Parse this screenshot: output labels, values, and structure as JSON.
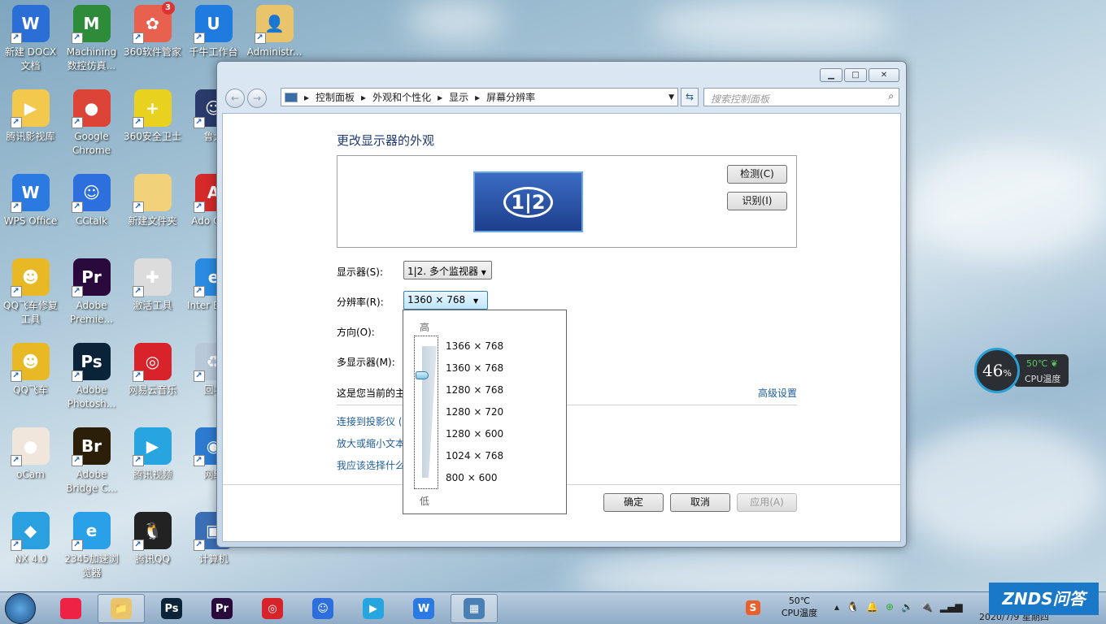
{
  "desktop_icons": [
    {
      "label": "新建 DOCX 文档",
      "glyph": "W",
      "color": "#2b6fd6"
    },
    {
      "label": "Machining 数控仿真...",
      "glyph": "M",
      "color": "#2e8b3a"
    },
    {
      "label": "360软件管家",
      "glyph": "✿",
      "color": "#e8614f",
      "badge": "3"
    },
    {
      "label": "千牛工作台",
      "glyph": "U",
      "color": "#1f7be0"
    },
    {
      "label": "Administr...",
      "glyph": "👤",
      "color": "#e9c46a"
    },
    {
      "label": "腾讯影视库",
      "glyph": "▶",
      "color": "#f2c94c"
    },
    {
      "label": "Google Chrome",
      "glyph": "●",
      "color": "#db4437"
    },
    {
      "label": "360安全卫士",
      "glyph": "+",
      "color": "#e8d21f"
    },
    {
      "label": "鲁大",
      "glyph": "☺",
      "color": "#2a3b6b"
    },
    {
      "label": "WPS Office",
      "glyph": "W",
      "color": "#2a7ae2"
    },
    {
      "label": "CCtalk",
      "glyph": "☺",
      "color": "#2d6fdc"
    },
    {
      "label": "新建文件夹",
      "glyph": "",
      "color": "#f1d27a"
    },
    {
      "label": "Ado Crea",
      "glyph": "A",
      "color": "#d42a2a"
    },
    {
      "label": "QQ飞车修复工具",
      "glyph": "☻",
      "color": "#e9b825"
    },
    {
      "label": "Adobe Premie...",
      "glyph": "Pr",
      "color": "#2a0a3d"
    },
    {
      "label": "激活工具",
      "glyph": "✚",
      "color": "#dcdcdc"
    },
    {
      "label": "Inter Explo",
      "glyph": "e",
      "color": "#2b8be0"
    },
    {
      "label": "QQ飞车",
      "glyph": "☻",
      "color": "#e9b825"
    },
    {
      "label": "Adobe Photosh...",
      "glyph": "Ps",
      "color": "#0b2338"
    },
    {
      "label": "网易云音乐",
      "glyph": "◎",
      "color": "#d8232a"
    },
    {
      "label": "回收",
      "glyph": "♻",
      "color": "#b8c8d8"
    },
    {
      "label": "oCam",
      "glyph": "●",
      "color": "#f0e6dc"
    },
    {
      "label": "Adobe Bridge C...",
      "glyph": "Br",
      "color": "#2b1f0a"
    },
    {
      "label": "腾讯视频",
      "glyph": "▶",
      "color": "#27a5e0"
    },
    {
      "label": "网络",
      "glyph": "◉",
      "color": "#2c7bd1"
    },
    {
      "label": "NX 4.0",
      "glyph": "◆",
      "color": "#2aa0e0"
    },
    {
      "label": "2345加速浏览器",
      "glyph": "e",
      "color": "#2aa0e8"
    },
    {
      "label": "腾讯QQ",
      "glyph": "🐧",
      "color": "#222"
    },
    {
      "label": "计算机",
      "glyph": "▣",
      "color": "#3b6fb5"
    }
  ],
  "window": {
    "breadcrumb": [
      "控制面板",
      "外观和个性化",
      "显示",
      "屏幕分辨率"
    ],
    "search_placeholder": "搜索控制面板",
    "title": "更改显示器的外观",
    "monitor_label": "1|2",
    "detect": "检测(C)",
    "identify": "识别(I)",
    "display_label": "显示器(S):",
    "display_value": "1|2. 多个监视器",
    "resolution_label": "分辨率(R):",
    "resolution_value": "1360 × 768",
    "orientation_label": "方向(O):",
    "multi_label": "多显示器(M):",
    "current_text": "这是您当前的主",
    "advanced": "高级设置",
    "links": [
      "连接到投影仪 (",
      "放大或缩小文本",
      "我应该选择什么"
    ],
    "ok": "确定",
    "cancel": "取消",
    "apply": "应用(A)"
  },
  "dropdown": {
    "high": "高",
    "low": "低",
    "options": [
      "1366 × 768",
      "1360 × 768",
      "1280 × 768",
      "1280 × 720",
      "1280 × 600",
      "1024 × 768",
      "800 × 600"
    ],
    "selected_index": 1
  },
  "cpu_widget": {
    "usage": "46",
    "unit": "%",
    "temp": "50℃",
    "label": "CPU温度"
  },
  "taskbar": {
    "apps": [
      {
        "g": "",
        "c": "#e24"
      },
      {
        "g": "📁",
        "c": "#e9c46a"
      },
      {
        "g": "Ps",
        "c": "#0b2338"
      },
      {
        "g": "Pr",
        "c": "#2a0a3d"
      },
      {
        "g": "◎",
        "c": "#d8232a"
      },
      {
        "g": "☺",
        "c": "#2d6fdc"
      },
      {
        "g": "▶",
        "c": "#27a5e0"
      },
      {
        "g": "W",
        "c": "#2a7ae2"
      },
      {
        "g": "▦",
        "c": "#4a7fb5"
      }
    ],
    "tray_temp": "50℃",
    "tray_label": "CPU温度",
    "clock": "2020/7/9 星期四",
    "watermark": "ZNDS问答"
  }
}
